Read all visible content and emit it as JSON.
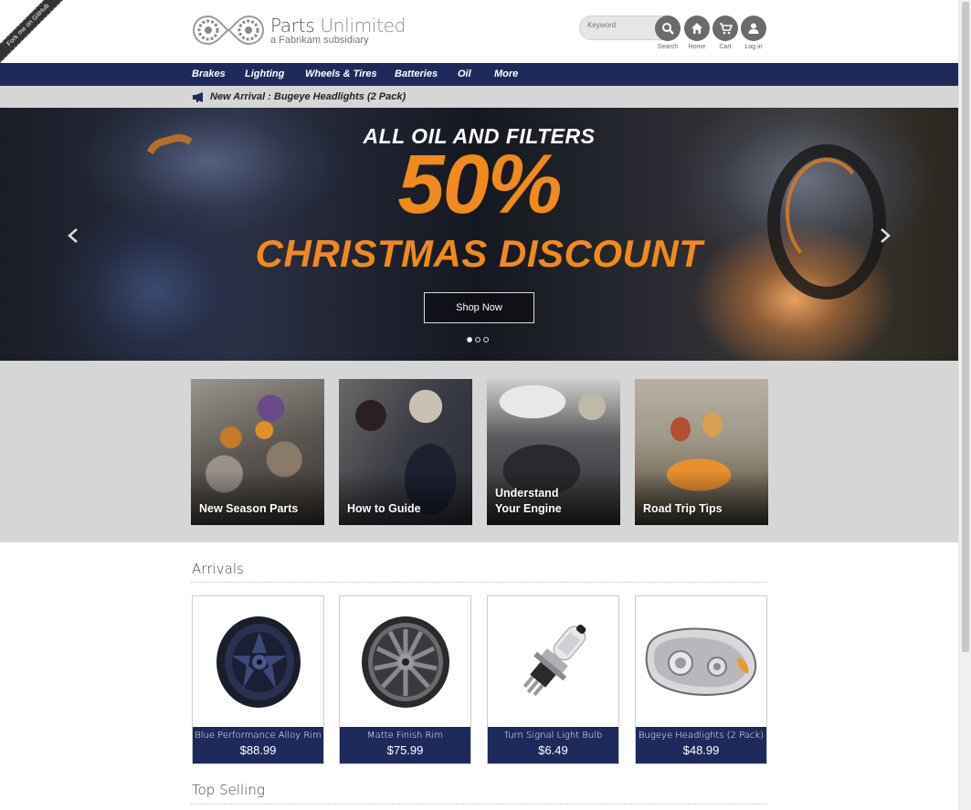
{
  "ribbon": {
    "text": "Fork me on GitHub"
  },
  "brand": {
    "name_part1": "Parts ",
    "name_part2": "Unlimited",
    "subtitle": "a Fabrikam subsidiary"
  },
  "search": {
    "placeholder": "Keyword"
  },
  "header_icons": [
    {
      "label": "Search",
      "icon": "search-icon"
    },
    {
      "label": "Home",
      "icon": "home-icon"
    },
    {
      "label": "Cart",
      "icon": "cart-icon"
    },
    {
      "label": "Log in",
      "icon": "user-icon"
    }
  ],
  "nav": {
    "items": [
      "Brakes",
      "Lighting",
      "Wheels & Tires",
      "Batteries",
      "Oil",
      "More"
    ]
  },
  "announcement": {
    "icon": "megaphone-icon",
    "text": "New Arrival : Bugeye Headlights (2 Pack)"
  },
  "hero": {
    "line1": "ALL OIL AND FILTERS",
    "big": "50%",
    "line3": "CHRISTMAS DISCOUNT",
    "button": "Shop Now",
    "slide_count": 3,
    "active_slide": 1
  },
  "tiles": [
    {
      "label": "New Season Parts"
    },
    {
      "label": "How to Guide"
    },
    {
      "label": "Understand Your Engine"
    },
    {
      "label": "Road Trip Tips"
    }
  ],
  "arrivals": {
    "title": "Arrivals",
    "products": [
      {
        "name": "Blue Performance Alloy Rim",
        "price": "$88.99"
      },
      {
        "name": "Matte Finish Rim",
        "price": "$75.99"
      },
      {
        "name": "Turn Signal Light Bulb",
        "price": "$6.49"
      },
      {
        "name": "Bugeye Headlights (2 Pack)",
        "price": "$48.99"
      }
    ]
  },
  "top_selling": {
    "title": "Top Selling"
  },
  "colors": {
    "nav_bg": "#1f2a5c",
    "accent_orange": "#f08a1c",
    "band_gray": "#d6d6d6"
  }
}
